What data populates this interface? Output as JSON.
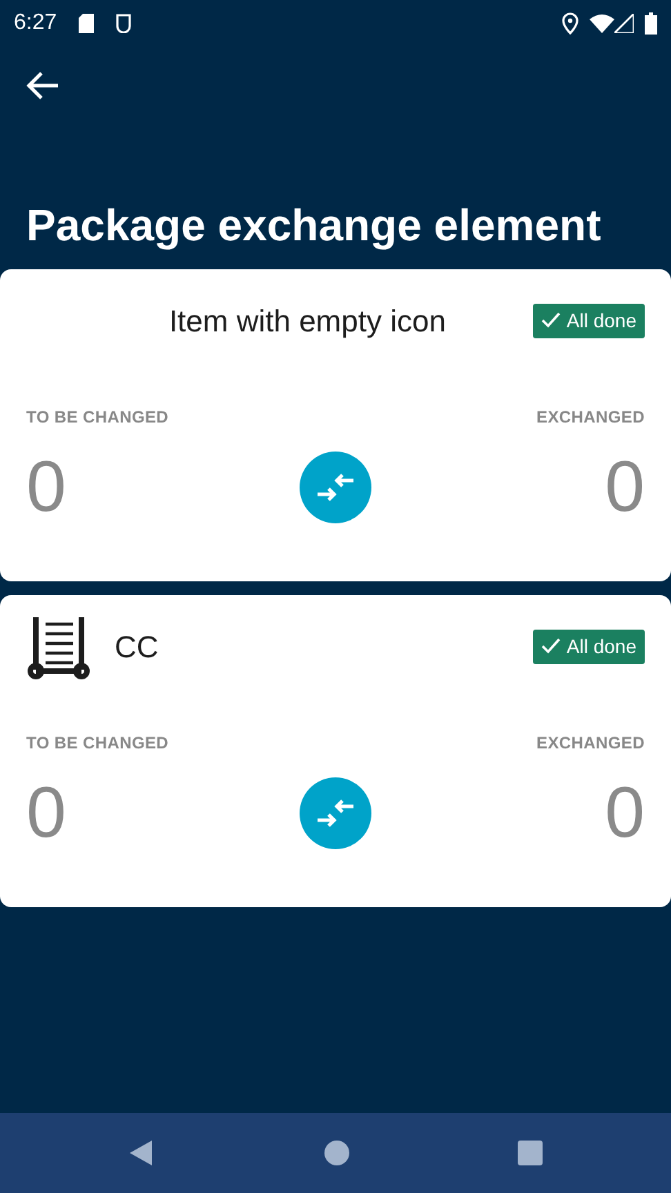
{
  "status_bar": {
    "time": "6:27"
  },
  "title": "Package exchange element",
  "cards": [
    {
      "kind": "no-icon",
      "name": "Item with empty icon",
      "badge": "All done",
      "left_label": "TO BE CHANGED",
      "left_value": "0",
      "right_label": "EXCHANGED",
      "right_value": "0"
    },
    {
      "kind": "trolley",
      "name": "CC",
      "badge": "All done",
      "left_label": "TO BE CHANGED",
      "left_value": "0",
      "right_label": "EXCHANGED",
      "right_value": "0"
    }
  ]
}
